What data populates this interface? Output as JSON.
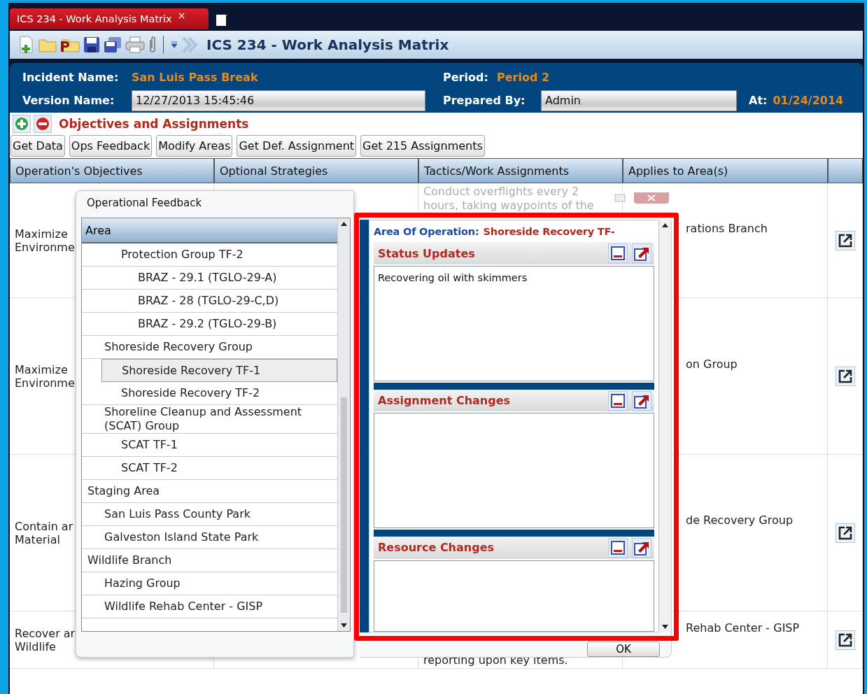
{
  "tab": {
    "title": "ICS 234 - Work Analysis Matrix",
    "close": "×"
  },
  "toolbar": {
    "title": "ICS 234 - Work Analysis Matrix"
  },
  "header": {
    "incident_label": "Incident Name:",
    "incident_value": "San Luis Pass Break",
    "period_label": "Period:",
    "period_value": "Period 2",
    "version_label": "Version Name:",
    "version_value": "12/27/2013 15:45:46",
    "prepared_label": "Prepared By:",
    "prepared_value": "Admin",
    "at_label": "At:",
    "at_value": "01/24/2014"
  },
  "section_title": "Objectives and Assignments",
  "buttons": [
    "Get Data",
    "Ops Feedback",
    "Modify Areas",
    "Get Def. Assignment",
    "Get 215 Assignments"
  ],
  "table": {
    "columns": [
      "Operation's Objectives",
      "Optional Strategies",
      "Tactics/Work Assignments",
      "Applies to Area(s)"
    ],
    "rows": [
      {
        "objective": "Maximize\nEnvironme",
        "tactic": "Conduct overflights every 2\nhours, taking waypoints of the",
        "area": "rations Branch"
      },
      {
        "objective": "Maximize\nEnvironme",
        "area": "on Group"
      },
      {
        "objective": "Contain ar\nMaterial",
        "area": "de Recovery Group"
      },
      {
        "objective": "Recover ar\nWildlife",
        "tactic": "reporting upon key items.",
        "area": "Rehab Center - GISP"
      }
    ]
  },
  "dialog": {
    "title": "Operational Feedback",
    "list_header": "Area",
    "tree": [
      {
        "children": [
          {
            "children": [
              {
                "label": "Protection Group TF-2",
                "selected": false,
                "children": [
                  {
                    "label": "BRAZ - 29.1 (TGLO-29-A)",
                    "selected": false
                  },
                  {
                    "label": "BRAZ - 28 (TGLO-29-C,D)",
                    "selected": false
                  },
                  {
                    "label": "BRAZ - 29.2 (TGLO-29-B)",
                    "selected": false
                  }
                ]
              }
            ]
          },
          {
            "label": "Shoreside Recovery Group",
            "selected": false,
            "children": [
              {
                "label": "Shoreside Recovery TF-1",
                "selected": true
              },
              {
                "label": "Shoreside Recovery TF-2",
                "selected": false
              }
            ]
          },
          {
            "label": "Shoreline Cleanup and Assessment (SCAT) Group",
            "selected": false,
            "children": [
              {
                "label": "SCAT TF-1",
                "selected": false
              },
              {
                "label": "SCAT TF-2",
                "selected": false
              }
            ]
          }
        ]
      },
      {
        "label": "Staging Area",
        "selected": false,
        "children": [
          {
            "label": "San Luis Pass County Park",
            "selected": false
          },
          {
            "label": "Galveston Island State Park",
            "selected": false
          }
        ]
      },
      {
        "label": "Wildlife Branch",
        "selected": false,
        "children": [
          {
            "label": "Hazing Group",
            "selected": false
          },
          {
            "label": "Wildlife Rehab Center - GISP",
            "selected": false
          }
        ]
      }
    ],
    "area_label": "Area Of Operation:",
    "area_value": "Shoreside Recovery TF-",
    "sections": [
      {
        "title": "Status Updates",
        "text": "Recovering oil with skimmers"
      },
      {
        "title": "Assignment Changes"
      },
      {
        "title": "Resource Changes"
      }
    ],
    "ok": "OK"
  }
}
